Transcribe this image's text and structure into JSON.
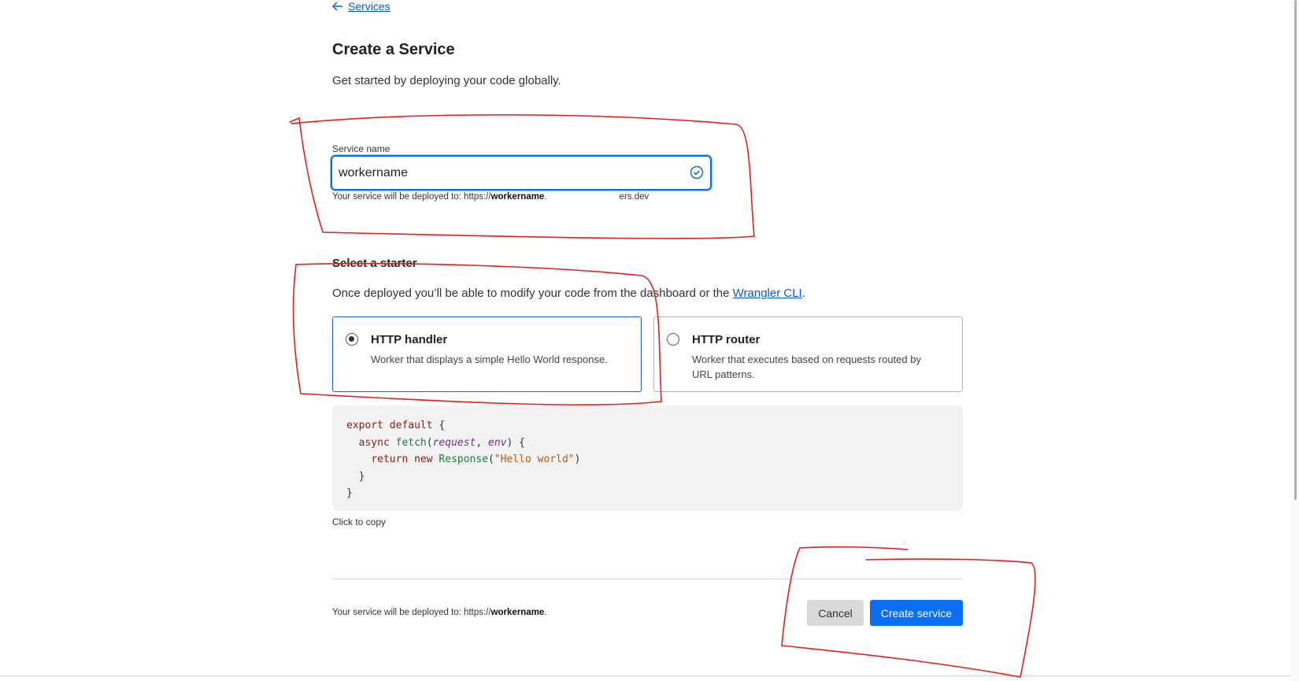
{
  "breadcrumb": {
    "back_label": "Services"
  },
  "header": {
    "title": "Create a Service",
    "subtitle": "Get started by deploying your code globally."
  },
  "service_name": {
    "label": "Service name",
    "value": "workername",
    "hint_prefix": "Your service will be deployed to: https://",
    "hint_name": "workername",
    "hint_suffix_partial": "ers.dev"
  },
  "starter": {
    "title": "Select a starter",
    "desc_prefix": "Once deployed you’ll be able to modify your code from the dashboard or the ",
    "desc_link": "Wrangler CLI",
    "desc_suffix": ".",
    "options": [
      {
        "title": "HTTP handler",
        "desc": "Worker that displays a simple Hello World response.",
        "selected": true
      },
      {
        "title": "HTTP router",
        "desc": "Worker that executes based on requests routed by URL patterns.",
        "selected": false
      }
    ]
  },
  "code": {
    "lines": [
      "export default {",
      "  async fetch(request, env) {",
      "    return new Response(\"Hello world\")",
      "  }",
      "}"
    ],
    "copy_hint": "Click to copy"
  },
  "footer": {
    "hint_prefix": "Your service will be deployed to: https://",
    "hint_name": "workername",
    "hint_suffix": ".",
    "cancel_label": "Cancel",
    "create_label": "Create service"
  },
  "colors": {
    "primary": "#0b6ff2",
    "link": "#0a5ad6",
    "annotation": "#e0201c"
  },
  "icons": [
    "arrow-left-icon",
    "check-circle-icon"
  ]
}
